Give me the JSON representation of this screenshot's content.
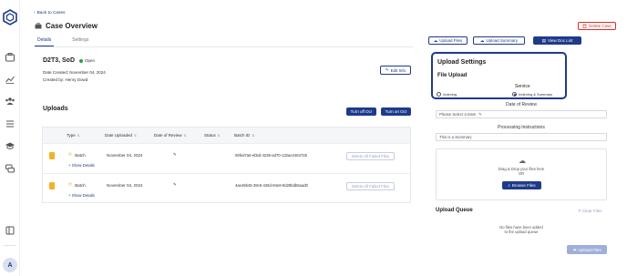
{
  "header": {
    "back_label": "Back to Cases",
    "title": "Case Overview",
    "delete_label": "Delete Case",
    "tabs": [
      {
        "label": "Details"
      },
      {
        "label": "Settings"
      }
    ]
  },
  "toolbar": {
    "upload_files": "Upload Files",
    "upload_summary": "Upload Summary",
    "view_doc_list": "View Doc List"
  },
  "case": {
    "name": "D2T3, SoD",
    "status": "Open",
    "date_created": "Date Created: November 04, 2024",
    "created_by": "Created by: Henry Dowd",
    "edit_info": "Edit Info"
  },
  "uploads": {
    "title": "Uploads",
    "turn_off_ocr": "Turn off Ocr",
    "turn_on_ocr": "Turn on Ocr",
    "columns": [
      "Type",
      "Date Uploaded",
      "Date of Review",
      "Status",
      "Batch ID"
    ],
    "rows": [
      {
        "type": "Batch",
        "date_uploaded": "November 04, 2024",
        "batch_id": "06fed7a6-ebbd-4236-ad70-132ae2464725",
        "show_details": "Show Details",
        "action": "Delete All Failed Files"
      },
      {
        "type": "Batch",
        "date_uploaded": "November 04, 2024",
        "batch_id": "4ae46b45-38c6-426d-84e8-9d28bdb5aad0",
        "show_details": "Show Details",
        "action": "Delete All Failed Files"
      }
    ]
  },
  "upload_settings": {
    "title": "Upload Settings",
    "file_upload": "File Upload",
    "service_label": "Service",
    "options": [
      {
        "label": "Indexing",
        "checked": false
      },
      {
        "label": "Indexing & Summary",
        "checked": true
      }
    ]
  },
  "review": {
    "label": "Date of Review",
    "placeholder": "Please Select a Date"
  },
  "instructions": {
    "label": "Processing Instructions",
    "value": "This is a Summary"
  },
  "dropzone": {
    "line1": "Drag & Drop your files here",
    "line2": "OR",
    "browse": "Browse Files"
  },
  "queue": {
    "title": "Upload Queue",
    "clear": "Clear Files",
    "empty_line1": "No files have been added",
    "empty_line2": "to the upload queue",
    "upload_button": "Upload Files"
  },
  "user": {
    "initial": "A"
  },
  "colors": {
    "primary": "#1e3a8a",
    "danger": "#d93025",
    "open": "#22a352",
    "file": "#f0b429"
  }
}
